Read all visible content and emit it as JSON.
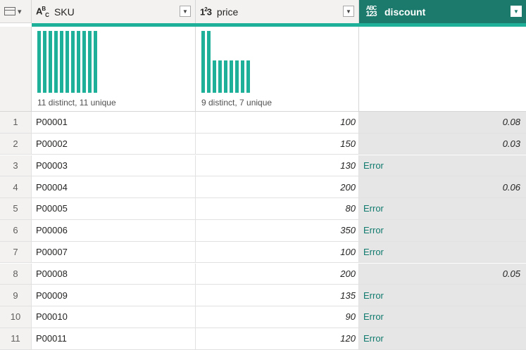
{
  "columns": {
    "sku": {
      "type_icon": "ABC",
      "name": "SKU"
    },
    "price": {
      "type_icon": "123",
      "name": "price"
    },
    "discount": {
      "type_icon": "ABC 123",
      "name": "discount"
    }
  },
  "profile": {
    "sku": {
      "stat": "11 distinct, 11 unique",
      "bar_heights": [
        1,
        1,
        1,
        1,
        1,
        1,
        1,
        1,
        1,
        1,
        1
      ]
    },
    "price": {
      "stat": "9 distinct, 7 unique",
      "bar_heights": [
        1,
        1,
        0.52,
        0.52,
        0.52,
        0.52,
        0.52,
        0.52,
        0.52
      ]
    }
  },
  "rows": [
    {
      "idx": "1",
      "sku": "P00001",
      "price": "100",
      "discount": "0.08",
      "error": false
    },
    {
      "idx": "2",
      "sku": "P00002",
      "price": "150",
      "discount": "0.03",
      "error": false
    },
    {
      "idx": "3",
      "sku": "P00003",
      "price": "130",
      "discount": "Error",
      "error": true
    },
    {
      "idx": "4",
      "sku": "P00004",
      "price": "200",
      "discount": "0.06",
      "error": false
    },
    {
      "idx": "5",
      "sku": "P00005",
      "price": "80",
      "discount": "Error",
      "error": true
    },
    {
      "idx": "6",
      "sku": "P00006",
      "price": "350",
      "discount": "Error",
      "error": true
    },
    {
      "idx": "7",
      "sku": "P00007",
      "price": "100",
      "discount": "Error",
      "error": true
    },
    {
      "idx": "8",
      "sku": "P00008",
      "price": "200",
      "discount": "0.05",
      "error": false
    },
    {
      "idx": "9",
      "sku": "P00009",
      "price": "135",
      "discount": "Error",
      "error": true
    },
    {
      "idx": "10",
      "sku": "P00010",
      "price": "90",
      "discount": "Error",
      "error": true
    },
    {
      "idx": "11",
      "sku": "P00011",
      "price": "120",
      "discount": "Error",
      "error": true
    }
  ],
  "colors": {
    "accent": "#1fb09a",
    "selected_header": "#1b7a6c",
    "error_text": "#0f7a6d"
  }
}
